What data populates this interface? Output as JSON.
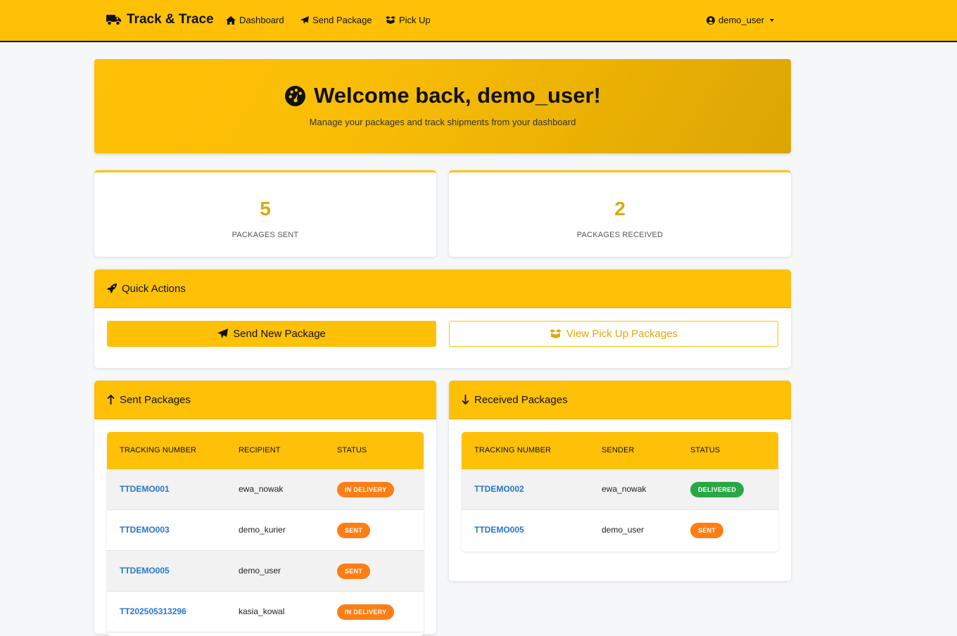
{
  "navbar": {
    "brand": "Track & Trace",
    "links": [
      {
        "label": "Dashboard",
        "icon": "home-icon"
      },
      {
        "label": "Send Package",
        "icon": "paper-plane-icon"
      },
      {
        "label": "Pick Up",
        "icon": "box-open-icon"
      }
    ],
    "user": "demo_user"
  },
  "hero": {
    "title": "Welcome back, demo_user!",
    "subtitle": "Manage your packages and track shipments from your dashboard"
  },
  "stats": [
    {
      "value": "5",
      "label": "PACKAGES SENT"
    },
    {
      "value": "2",
      "label": "PACKAGES RECEIVED"
    }
  ],
  "quick_actions": {
    "title": "Quick Actions",
    "send_label": "Send New Package",
    "pickup_label": "View Pick Up Packages"
  },
  "sent": {
    "title": "Sent Packages",
    "columns": [
      "TRACKING NUMBER",
      "RECIPIENT",
      "STATUS"
    ],
    "rows": [
      {
        "tracking": "TTDEMO001",
        "party": "ewa_nowak",
        "status": "IN DELIVERY",
        "status_color": "#fd7e14"
      },
      {
        "tracking": "TTDEMO003",
        "party": "demo_kurier",
        "status": "SENT",
        "status_color": "#fd7e14"
      },
      {
        "tracking": "TTDEMO005",
        "party": "demo_user",
        "status": "SENT",
        "status_color": "#fd7e14"
      },
      {
        "tracking": "TT202505313296",
        "party": "kasia_kowal",
        "status": "IN DELIVERY",
        "status_color": "#fd7e14"
      }
    ]
  },
  "received": {
    "title": "Received Packages",
    "columns": [
      "TRACKING NUMBER",
      "SENDER",
      "STATUS"
    ],
    "rows": [
      {
        "tracking": "TTDEMO002",
        "party": "ewa_nowak",
        "status": "DELIVERED",
        "status_color": "#28a745"
      },
      {
        "tracking": "TTDEMO005",
        "party": "demo_user",
        "status": "SENT",
        "status_color": "#fd7e14"
      }
    ]
  },
  "colors": {
    "accent": "#ffc107",
    "link": "#2476d3",
    "stat_number": "#dfa807"
  }
}
